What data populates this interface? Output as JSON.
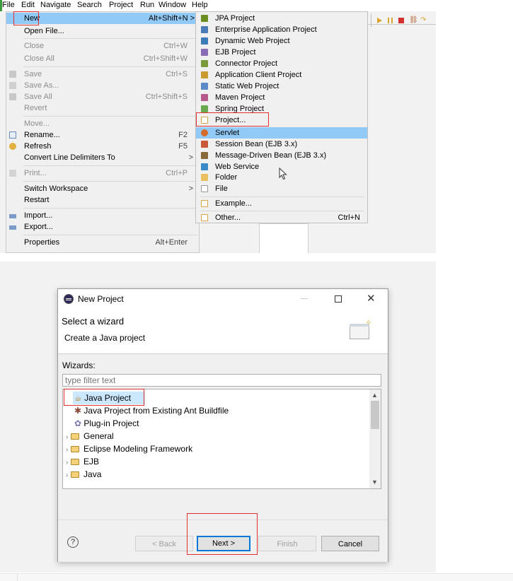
{
  "menubar": {
    "items": [
      "File",
      "Edit",
      "Navigate",
      "Search",
      "Project",
      "Run",
      "Window",
      "Help"
    ]
  },
  "file_menu": {
    "items": [
      {
        "label": "New",
        "accel": "Alt+Shift+N >",
        "disabled": false,
        "highlight": true
      },
      {
        "label": "Open File...",
        "accel": "",
        "disabled": false
      },
      {
        "label": "Close",
        "accel": "Ctrl+W",
        "disabled": true
      },
      {
        "label": "Close All",
        "accel": "Ctrl+Shift+W",
        "disabled": true
      },
      {
        "label": "Save",
        "accel": "Ctrl+S",
        "disabled": true
      },
      {
        "label": "Save As...",
        "accel": "",
        "disabled": true
      },
      {
        "label": "Save All",
        "accel": "Ctrl+Shift+S",
        "disabled": true
      },
      {
        "label": "Revert",
        "accel": "",
        "disabled": true
      },
      {
        "label": "Move...",
        "accel": "",
        "disabled": true
      },
      {
        "label": "Rename...",
        "accel": "F2",
        "disabled": false
      },
      {
        "label": "Refresh",
        "accel": "F5",
        "disabled": false
      },
      {
        "label": "Convert Line Delimiters To",
        "accel": ">",
        "disabled": false
      },
      {
        "label": "Print...",
        "accel": "Ctrl+P",
        "disabled": true
      },
      {
        "label": "Switch Workspace",
        "accel": ">",
        "disabled": false
      },
      {
        "label": "Restart",
        "accel": "",
        "disabled": false
      },
      {
        "label": "Import...",
        "accel": "",
        "disabled": false
      },
      {
        "label": "Export...",
        "accel": "",
        "disabled": false
      },
      {
        "label": "Properties",
        "accel": "Alt+Enter",
        "disabled": false
      }
    ]
  },
  "new_submenu": {
    "items": [
      {
        "label": "JPA Project",
        "icon": "jpa-project-icon",
        "color": "#6b8e23"
      },
      {
        "label": "Enterprise Application Project",
        "icon": "ear-project-icon",
        "color": "#4a7bb7"
      },
      {
        "label": "Dynamic Web Project",
        "icon": "web-project-icon",
        "color": "#3d7ab8"
      },
      {
        "label": "EJB Project",
        "icon": "ejb-project-icon",
        "color": "#8a6bb5"
      },
      {
        "label": "Connector Project",
        "icon": "connector-project-icon",
        "color": "#7a9a3a"
      },
      {
        "label": "Application Client Project",
        "icon": "app-client-icon",
        "color": "#c89a30"
      },
      {
        "label": "Static Web Project",
        "icon": "static-web-icon",
        "color": "#5a8ac8"
      },
      {
        "label": "Maven Project",
        "icon": "maven-icon",
        "color": "#b55a8a"
      },
      {
        "label": "Spring Project",
        "icon": "spring-icon",
        "color": "#6aa84f"
      },
      {
        "label": "Project...",
        "icon": "project-icon",
        "color": "#d9a441"
      },
      {
        "label": "Servlet",
        "icon": "servlet-icon",
        "color": "#d46a2a",
        "highlight": true
      },
      {
        "label": "Session Bean (EJB 3.x)",
        "icon": "session-bean-icon",
        "color": "#c85a3a"
      },
      {
        "label": "Message-Driven Bean (EJB 3.x)",
        "icon": "mdb-icon",
        "color": "#8a6a3a"
      },
      {
        "label": "Web Service",
        "icon": "web-service-icon",
        "color": "#3a8ac8"
      },
      {
        "label": "Folder",
        "icon": "folder-icon",
        "color": "#e8c060"
      },
      {
        "label": "File",
        "icon": "file-icon",
        "color": "#ffffff"
      },
      {
        "label": "Example...",
        "icon": "example-icon",
        "color": "#d9a441"
      },
      {
        "label": "Other...",
        "icon": "other-icon",
        "color": "#d9a441",
        "accel": "Ctrl+N"
      }
    ]
  },
  "dialog": {
    "title": "New Project",
    "heading": "Select a wizard",
    "description": "Create a Java project",
    "wizards_label": "Wizards:",
    "filter_placeholder": "type filter text",
    "tree": [
      {
        "label": "Java Project",
        "indent": 1,
        "selected": true
      },
      {
        "label": "Java Project from Existing Ant Buildfile",
        "indent": 1
      },
      {
        "label": "Plug-in Project",
        "indent": 1
      },
      {
        "label": "General",
        "indent": 0,
        "folder": true
      },
      {
        "label": "Eclipse Modeling Framework",
        "indent": 0,
        "folder": true
      },
      {
        "label": "EJB",
        "indent": 0,
        "folder": true
      },
      {
        "label": "Java",
        "indent": 0,
        "folder": true
      }
    ],
    "buttons": {
      "help": "?",
      "back": "< Back",
      "next": "Next >",
      "finish": "Finish",
      "cancel": "Cancel"
    }
  }
}
